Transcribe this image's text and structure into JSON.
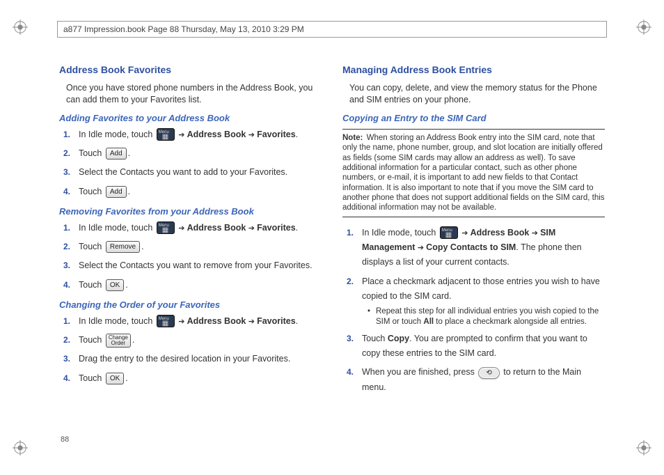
{
  "header": "a877 Impression.book  Page 88  Thursday, May 13, 2010  3:29 PM",
  "pageNumber": "88",
  "btn": {
    "add": "Add",
    "remove": "Remove",
    "ok": "OK",
    "changeOrder": "Change\nOrder"
  },
  "nav": {
    "addressBook": "Address Book",
    "favorites": "Favorites",
    "simMgmt": "SIM Management",
    "copyToSim": "Copy Contacts to SIM"
  },
  "left": {
    "h1": "Address Book Favorites",
    "intro": "Once you have stored phone numbers in the Address Book, you can add them to your Favorites list.",
    "sec1": {
      "title": "Adding Favorites to your Address Book",
      "s1a": " In Idle mode, touch ",
      "s2a": "Touch ",
      "s3": "Select the Contacts you want to add to your Favorites.",
      "s4a": "Touch "
    },
    "sec2": {
      "title": "Removing Favorites from your Address Book",
      "s1a": " In Idle mode, touch ",
      "s2a": "Touch ",
      "s3": "Select the Contacts you want to remove from your Favorites.",
      "s4a": "Touch "
    },
    "sec3": {
      "title": "Changing the Order of your Favorites",
      "s1a": " In Idle mode, touch ",
      "s2a": "Touch ",
      "s3": "Drag the entry to the desired location in your Favorites.",
      "s4a": "Touch "
    }
  },
  "right": {
    "h1": "Managing Address Book Entries",
    "intro": "You can copy, delete, and view the memory status for the Phone and SIM entries on your phone.",
    "sec1": {
      "title": "Copying an Entry to the SIM Card",
      "noteLabel": "Note:",
      "noteBody": "When storing an Address Book entry into the SIM card, note that only the name, phone number, group, and slot location are initially offered as fields (some SIM cards may allow an address as well). To save additional information for a particular contact, such as other phone numbers, or e-mail, it is important to add new fields to that Contact information. It is also important to note that if you move the SIM card to another phone that does not support additional fields on the SIM card, this additional information may not be available.",
      "s1a": "In Idle mode, touch ",
      "s1b": ". The phone then displays a list of your current contacts.",
      "s2": "Place a checkmark adjacent to those entries you wish to have copied to the SIM card.",
      "s2sub_a": "Repeat this step for all individual entries you wish copied to the SIM or touch ",
      "s2sub_all": "All",
      "s2sub_b": " to place a checkmark alongside all entries.",
      "s3a": "Touch ",
      "s3copy": "Copy",
      "s3b": ". You are prompted to confirm that you want to copy these entries to the SIM card.",
      "s4a": "When you are finished, press ",
      "s4b": " to return to the Main menu."
    }
  }
}
